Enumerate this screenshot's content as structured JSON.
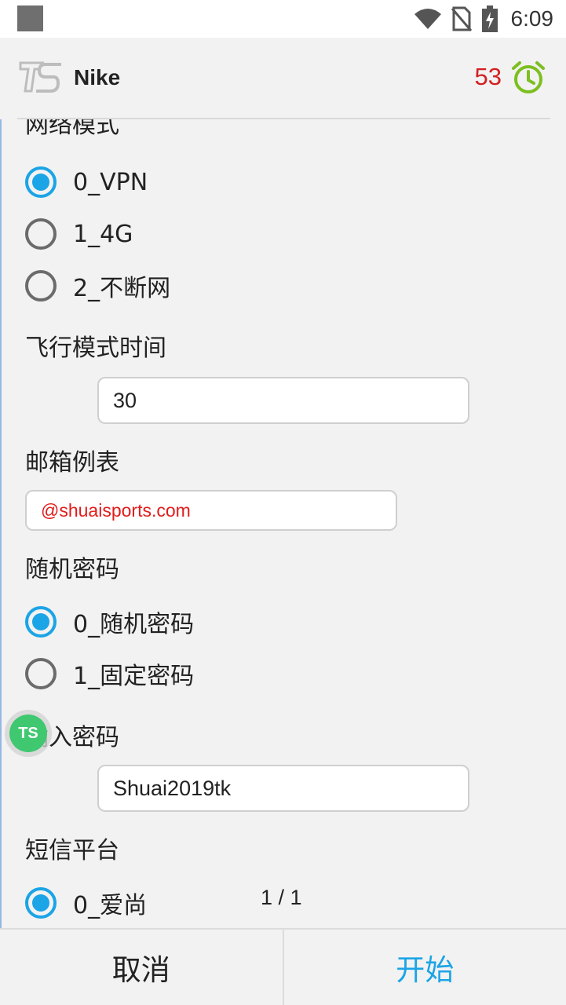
{
  "status_bar": {
    "time": "6:09",
    "icons": [
      "wifi-icon",
      "no-sim-icon",
      "battery-charging-icon"
    ]
  },
  "header": {
    "logo_text": "TS",
    "title": "Nike",
    "counter": "53",
    "alarm_icon": "alarm-clock-icon",
    "alarm_color": "#7cbf1f",
    "counter_color": "#d32020"
  },
  "form": {
    "network_mode": {
      "label": "网络模式",
      "options": [
        "0_VPN",
        "1_4G",
        "2_不断网"
      ],
      "selected": 0
    },
    "airplane_time": {
      "label": "飞行模式时间",
      "value": "30"
    },
    "email_list": {
      "label": "邮箱例表",
      "value": "@shuaisports.com"
    },
    "random_password": {
      "label": "随机密码",
      "options": [
        "0_随机密码",
        "1_固定密码"
      ],
      "selected": 0
    },
    "input_password": {
      "label": "输入密码",
      "value": "Shuai2019tk"
    },
    "sms_platform": {
      "label": "短信平台",
      "options": [
        "0_爱尚"
      ],
      "selected": 0
    }
  },
  "floating_button": {
    "text": "TS"
  },
  "page_indicator": "1 / 1",
  "bottom": {
    "cancel_label": "取消",
    "start_label": "开始"
  },
  "colors": {
    "accent": "#1ba4e6",
    "error_text": "#e21b1b",
    "floating_green": "#3fc870"
  }
}
